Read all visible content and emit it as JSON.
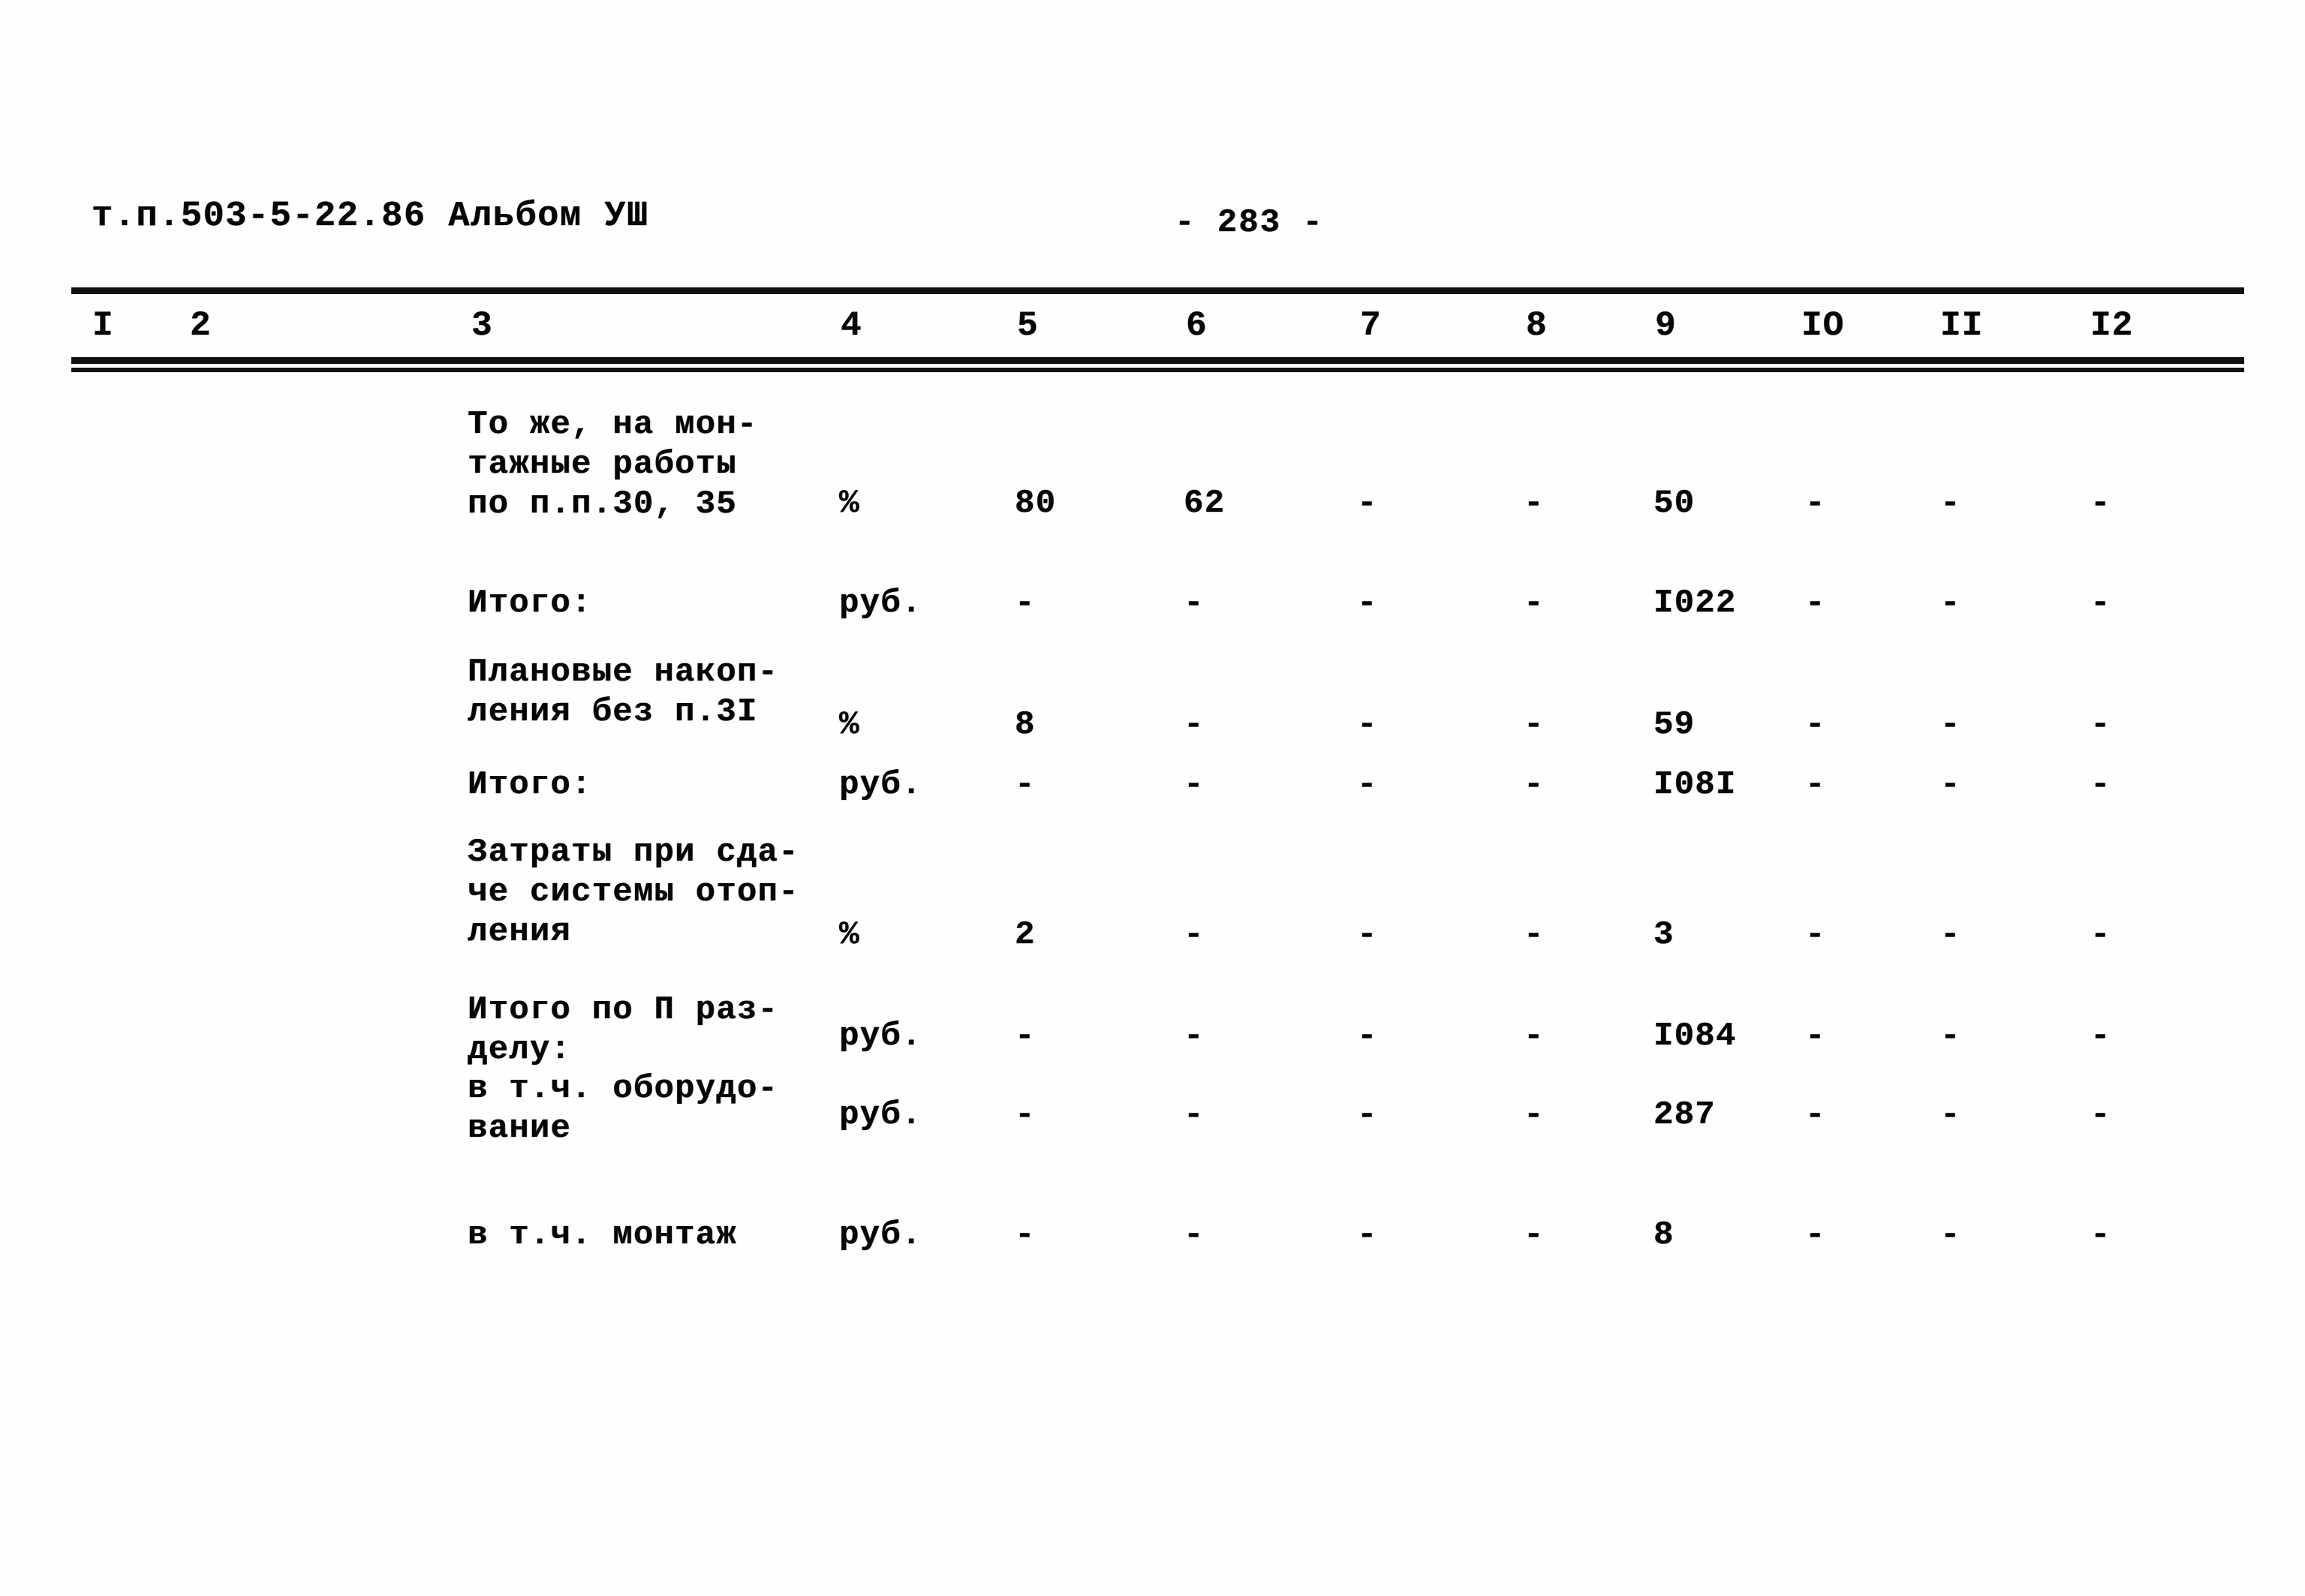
{
  "document": {
    "header_left": "т.п.503-5-22.86  Альбом УШ",
    "page_label": "- 283 -"
  },
  "table": {
    "column_headers": [
      "I",
      "2",
      "3",
      "4",
      "5",
      "6",
      "7",
      "8",
      "9",
      "IO",
      "II",
      "I2"
    ],
    "rows": [
      {
        "description": "То же, на мон-\nтажные работы\nпо п.п.30, 35",
        "c4": "%",
        "c5": "80",
        "c6": "62",
        "c7": "-",
        "c8": "-",
        "c9": "50",
        "c10": "-",
        "c11": "-",
        "c12": "-"
      },
      {
        "description": "Итого:",
        "c4": "руб.",
        "c5": "-",
        "c6": "-",
        "c7": "-",
        "c8": "-",
        "c9": "I022",
        "c10": "-",
        "c11": "-",
        "c12": "-"
      },
      {
        "description": "Плановые накоп-\nления без п.3I",
        "c4": "%",
        "c5": "8",
        "c6": "-",
        "c7": "-",
        "c8": "-",
        "c9": "59",
        "c10": "-",
        "c11": "-",
        "c12": "-"
      },
      {
        "description": "Итого:",
        "c4": "руб.",
        "c5": "-",
        "c6": "-",
        "c7": "-",
        "c8": "-",
        "c9": "I08I",
        "c10": "-",
        "c11": "-",
        "c12": "-"
      },
      {
        "description": "Затраты при сда-\nче системы отоп-\nления",
        "c4": "%",
        "c5": "2",
        "c6": "-",
        "c7": "-",
        "c8": "-",
        "c9": "3",
        "c10": "-",
        "c11": "-",
        "c12": "-"
      },
      {
        "description": "Итого по П раз-\nделу:",
        "c4": "руб.",
        "c5": "-",
        "c6": "-",
        "c7": "-",
        "c8": "-",
        "c9": "I084",
        "c10": "-",
        "c11": "-",
        "c12": "-"
      },
      {
        "description": "в т.ч. оборудо-\nвание",
        "c4": "руб.",
        "c5": "-",
        "c6": "-",
        "c7": "-",
        "c8": "-",
        "c9": "287",
        "c10": "-",
        "c11": "-",
        "c12": "-"
      },
      {
        "description": "в т.ч. монтаж",
        "c4": "руб.",
        "c5": "-",
        "c6": "-",
        "c7": "-",
        "c8": "-",
        "c9": "8",
        "c10": "-",
        "c11": "-",
        "c12": "-"
      }
    ]
  },
  "layout": {
    "col_header_x": [
      123,
      253,
      628,
      1120,
      1355,
      1580,
      1812,
      2033,
      2205,
      2400,
      2585,
      2785
    ],
    "row_tops": [
      0,
      238,
      345,
      480,
      590,
      790,
      900,
      1080
    ],
    "desc_tops": [
      0,
      238,
      330,
      480,
      570,
      780,
      885,
      1080
    ],
    "row_value_offsets": [
      105,
      0,
      70,
      0,
      110,
      35,
      35,
      0
    ]
  }
}
